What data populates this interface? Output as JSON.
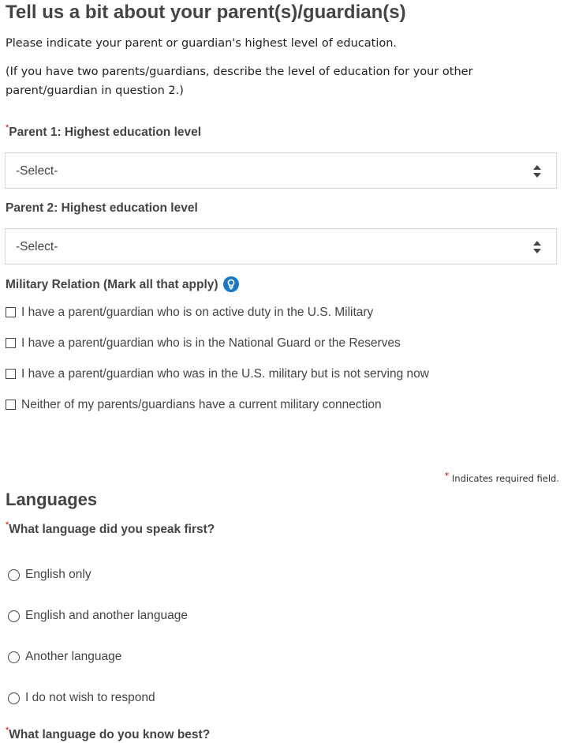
{
  "page": {
    "title": "Tell us a bit about your parent(s)/guardian(s)",
    "intro": "Please indicate your parent or guardian's highest level of education.",
    "note": "(If you have two parents/guardians, describe the level of education for your other parent/guardian in question 2.)"
  },
  "parent1": {
    "required_mark": "*",
    "label": "Parent 1: Highest education level",
    "value": "-Select-"
  },
  "parent2": {
    "label": "Parent 2: Highest education level",
    "value": "-Select-"
  },
  "military": {
    "label": "Military Relation (Mark all that apply)",
    "info_icon": "help-bulb-icon",
    "options": [
      "I have a parent/guardian who is on active duty in the U.S. Military",
      "I have a parent/guardian who is in the National Guard or the Reserves",
      "I have a parent/guardian who was in the U.S. military but is not serving now",
      "Neither of my parents/guardians have a current military connection"
    ]
  },
  "required_note": {
    "mark": "*",
    "text": "Indicates required field."
  },
  "languages": {
    "title": "Languages",
    "q1": {
      "required_mark": "*",
      "label": "What language did you speak first?",
      "options": [
        "English only",
        "English and another language",
        "Another language",
        "I do not wish to respond"
      ]
    },
    "q2": {
      "required_mark": "*",
      "label": "What language do you know best?"
    }
  },
  "colors": {
    "accent": "#1a78c2",
    "required": "#d00000",
    "text": "#444444",
    "border": "#d6d6d6"
  }
}
